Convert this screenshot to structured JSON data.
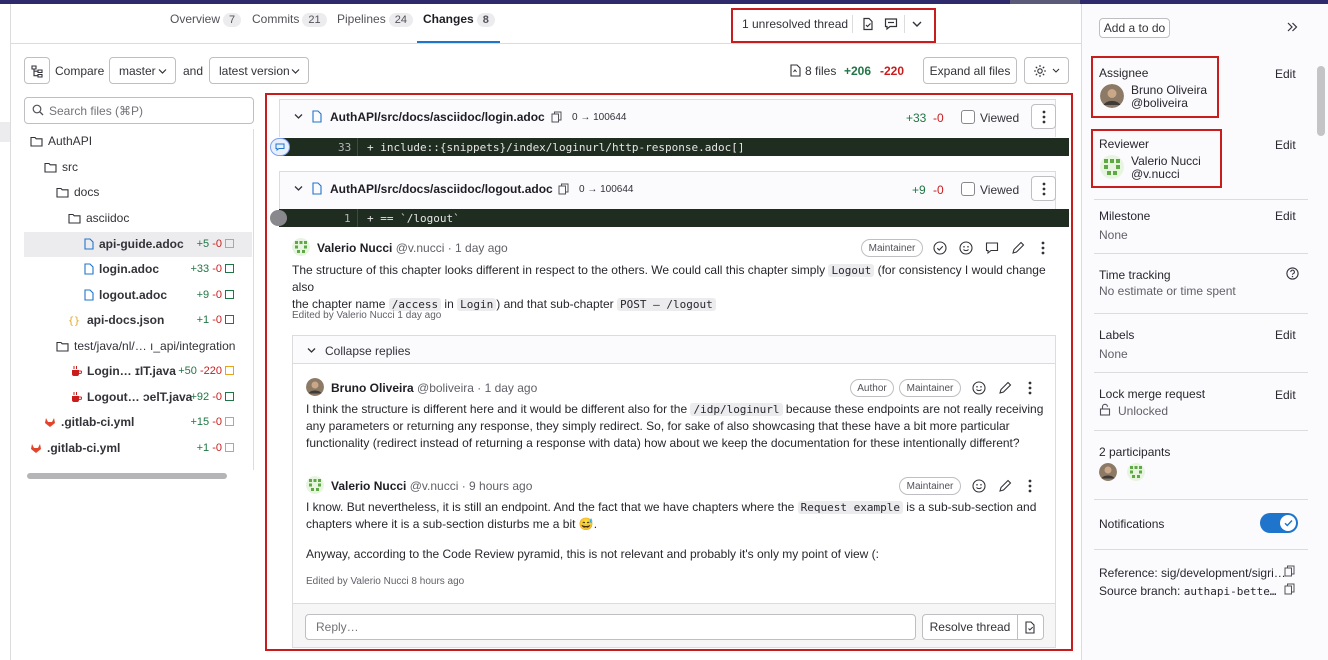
{
  "tabs": [
    {
      "label": "Overview",
      "count": "7"
    },
    {
      "label": "Commits",
      "count": "21"
    },
    {
      "label": "Pipelines",
      "count": "24"
    },
    {
      "label": "Changes",
      "count": "8"
    }
  ],
  "thread_nav": {
    "text": "1 unresolved thread"
  },
  "compare_bar": {
    "compare_label": "Compare",
    "source": "master",
    "and_label": "and",
    "target": "latest version",
    "files_count": "8 files",
    "additions": "+206",
    "deletions": "-220",
    "expand_label": "Expand all files"
  },
  "search": {
    "placeholder": "Search files (⌘P)"
  },
  "file_tree": [
    {
      "name": "AuthAPI",
      "type": "folder"
    },
    {
      "name": "src",
      "type": "folder"
    },
    {
      "name": "docs",
      "type": "folder"
    },
    {
      "name": "asciidoc",
      "type": "folder"
    },
    {
      "name": "api-guide.adoc",
      "type": "file",
      "add": "+5",
      "del": "-0",
      "status": "modified"
    },
    {
      "name": "login.adoc",
      "type": "file",
      "add": "+33",
      "del": "-0",
      "status": "added"
    },
    {
      "name": "logout.adoc",
      "type": "file",
      "add": "+9",
      "del": "-0",
      "status": "added"
    },
    {
      "name": "api-docs.json",
      "type": "json",
      "add": "+1",
      "del": "-0",
      "status": "added"
    },
    {
      "name": "test/java/nl/… ı_api/integration",
      "type": "folder"
    },
    {
      "name": "Login… ɪIT.java",
      "type": "java",
      "add": "+50",
      "del": "-220",
      "status": "modified"
    },
    {
      "name": "Logout… ɔelT.java",
      "type": "java",
      "add": "+92",
      "del": "-0",
      "status": "added"
    },
    {
      "name": ".gitlab-ci.yml",
      "type": "gitlab",
      "add": "+15",
      "del": "-0",
      "status": "modified"
    },
    {
      "name": ".gitlab-ci.yml",
      "type": "gitlab",
      "add": "+1",
      "del": "-0",
      "status": "modified"
    }
  ],
  "diff_files": [
    {
      "path": "AuthAPI/src/docs/asciidoc/login.adoc",
      "mode": "0 → 100644",
      "add": "+33",
      "del": "-0",
      "viewed_label": "Viewed",
      "line": {
        "num": "33",
        "code": "+ include::{snippets}/index/loginurl/http-response.adoc[]"
      }
    },
    {
      "path": "AuthAPI/src/docs/asciidoc/logout.adoc",
      "mode": "0 → 100644",
      "add": "+9",
      "del": "-0",
      "viewed_label": "Viewed",
      "line": {
        "num": "1",
        "code": "+ == `/logout`"
      }
    }
  ],
  "thread": {
    "comment": {
      "author": "Valerio Nucci",
      "handle": "@v.nucci · 1 day ago",
      "badge": "Maintainer",
      "t1": "The structure of this chapter looks different in respect to the others. We could call this chapter simply ",
      "c1": "Logout",
      "t2": " (for consistency I would change also",
      "t3": "the chapter name ",
      "c2": "/access",
      "t4": " in ",
      "c3": "Login",
      "t5": ") and that sub-chapter ",
      "c4": "POST – /logout",
      "edited": "Edited by Valerio Nucci 1 day ago"
    },
    "collapse_label": "Collapse replies",
    "reply1": {
      "author": "Bruno Oliveira",
      "handle": "@boliveira · 1 day ago",
      "badge1": "Author",
      "badge2": "Maintainer",
      "t1": "I think the structure is different here and it would be different also for the ",
      "c1": "/idp/loginurl",
      "t2": " because these endpoints are not really receiving",
      "l2": "any parameters or returning any response, they simply redirect. So, for sake of also showcasing that these have a bit more particular",
      "l3": "functionality (redirect instead of returning a response with data) how about we keep the documentation for these intentionally different?"
    },
    "reply2": {
      "author": "Valerio Nucci",
      "handle": "@v.nucci · 9 hours ago",
      "badge": "Maintainer",
      "t1": "I know. But nevertheless, it is still an endpoint. And the fact that we have chapters where the ",
      "c1": "Request example",
      "t2": " is a sub-sub-section and",
      "l2": "chapters where it is a sub-section disturbs me a bit 😅.",
      "p2": "Anyway, according to the Code Review pyramid, this is not relevant and probably it's only my point of view (:",
      "edited": "Edited by Valerio Nucci 8 hours ago"
    },
    "reply_placeholder": "Reply…",
    "resolve_label": "Resolve thread"
  },
  "sidebar": {
    "todo_label": "Add a to do",
    "edit_label": "Edit",
    "assignee": {
      "label": "Assignee",
      "name": "Bruno Oliveira",
      "handle": "@boliveira"
    },
    "reviewer": {
      "label": "Reviewer",
      "name": "Valerio Nucci",
      "handle": "@v.nucci"
    },
    "milestone": {
      "label": "Milestone",
      "value": "None"
    },
    "time_tracking": {
      "label": "Time tracking",
      "value": "No estimate or time spent"
    },
    "labels": {
      "label": "Labels",
      "value": "None"
    },
    "lock": {
      "label": "Lock merge request",
      "value": "Unlocked"
    },
    "participants": {
      "label": "2 participants"
    },
    "notifications": {
      "label": "Notifications",
      "enabled": true
    },
    "reference": "Reference: sig/development/sigri…",
    "source_branch_label": "Source branch: ",
    "source_branch": "authapi-bette…"
  },
  "colors": {
    "accent": "#1f75cb",
    "highlight_box": "#c91c1c",
    "added": "#217645",
    "removed": "#c91c1c"
  }
}
